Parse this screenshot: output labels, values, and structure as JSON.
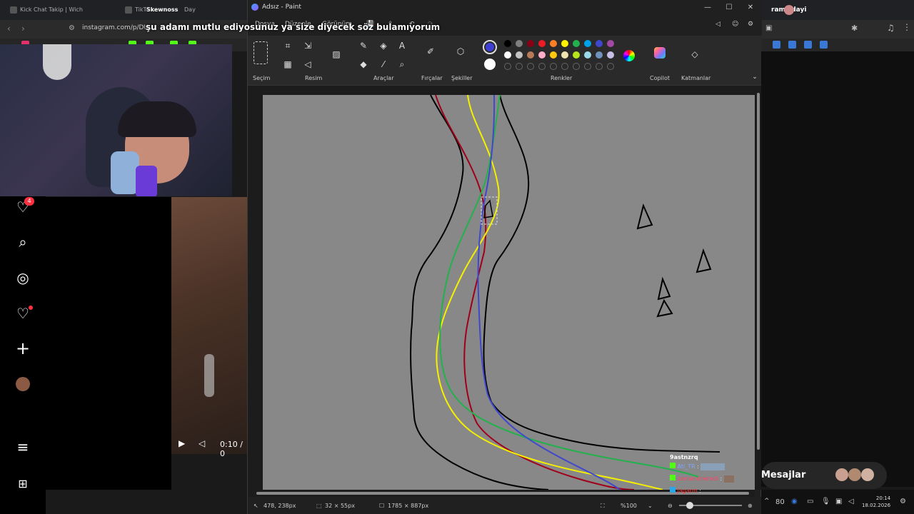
{
  "browser": {
    "tabs": [
      {
        "label": "Kick Chat Takip | Wich"
      },
      {
        "label": "TikTok"
      },
      {
        "label": "Skewnoss"
      },
      {
        "label": "Day"
      }
    ],
    "url": "instagram.com/p/DU..."
  },
  "overlay": {
    "caption": "şu adamı mutlu ediyosunuz ya size diyecek söz bulamıyorum"
  },
  "paint": {
    "title": "Adsız - Paint",
    "menu": [
      "Dosya",
      "Düzenle",
      "Görünüm"
    ],
    "ribbon_groups": {
      "selection": "Seçim",
      "image": "Resim",
      "tools": "Araçlar",
      "brushes": "Fırçalar",
      "shapes": "Şekiller",
      "colors": "Renkler",
      "copilot": "Copilot",
      "layers": "Katmanlar"
    },
    "color_palette": {
      "active_primary": "#3f3fd6",
      "active_secondary": "#ffffff",
      "row1": [
        "#000000",
        "#7f7f7f",
        "#880015",
        "#ed1c24",
        "#ff7f27",
        "#fff200",
        "#22b14c",
        "#00a2e8",
        "#3f48cc",
        "#a349a4"
      ],
      "row2": [
        "#ffffff",
        "#c3c3c3",
        "#b97a57",
        "#ffaec9",
        "#ffc90e",
        "#efe4b0",
        "#b5e61d",
        "#99d9ea",
        "#7092be",
        "#c8bfe7"
      ]
    },
    "status": {
      "cursor_pos": "478, 238px",
      "selection_size": "32 × 55px",
      "canvas_size": "1785 × 887px",
      "zoom": "%100"
    }
  },
  "chat": {
    "header": "9astnzrq",
    "messages": [
      {
        "user": "Ati_TR",
        "color": "#7aa7ff"
      },
      {
        "user": "zamandneredi",
        "color": "#ff4466"
      },
      {
        "user": "Jagarm",
        "color": "#ff3333"
      }
    ]
  },
  "instagram": {
    "notification_count": "4",
    "video_time": "0:10 / 0"
  },
  "user": {
    "name": "ramizdayi"
  },
  "messages_panel": {
    "label": "Mesajlar"
  },
  "tray": {
    "battery_or_number": "80",
    "time": "20:14",
    "date": "18.02.2026"
  }
}
